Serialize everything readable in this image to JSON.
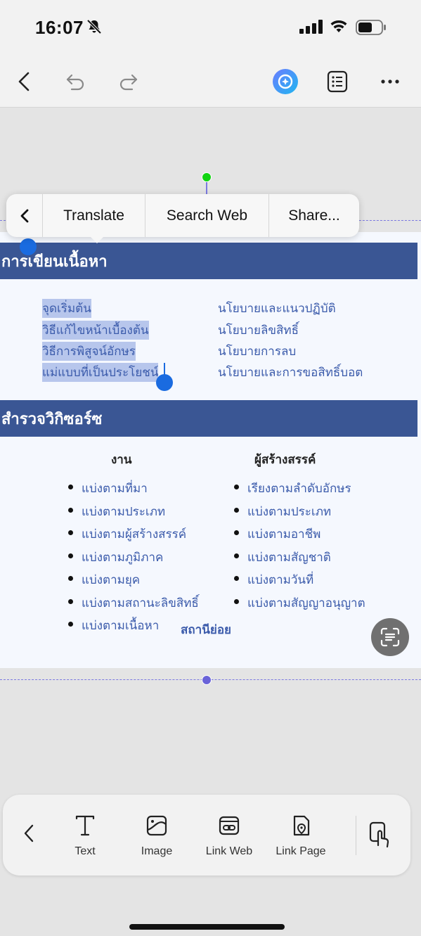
{
  "status": {
    "time": "16:07"
  },
  "toolbar": {
    "icons": [
      "back-icon",
      "undo-icon",
      "redo-icon",
      "ai-assistant-icon",
      "outline-icon",
      "more-icon"
    ]
  },
  "popup": {
    "items": [
      "Translate",
      "Search Web",
      "Share..."
    ]
  },
  "page": {
    "section1": {
      "title": "การเขียนเนื้อหา",
      "left_links": [
        "จุดเริ่มต้น",
        "วิธีแก้ไขหน้าเบื้องต้น",
        "วิธีการพิสูจน์อักษร",
        "แม่แบบที่เป็นประโยชน์"
      ],
      "right_links": [
        "นโยบายและแนวปฏิบัติ",
        "นโยบายลิขสิทธิ์",
        "นโยบายการลบ",
        "นโยบายและการขอสิทธิ์บอต"
      ]
    },
    "section2": {
      "title": "สำรวจวิกิซอร์ซ",
      "col1_title": "งาน",
      "col1_items": [
        "แบ่งตามที่มา",
        "แบ่งตามประเภท",
        "แบ่งตามผู้สร้างสรรค์",
        "แบ่งตามภูมิภาค",
        "แบ่งตามยุค",
        "แบ่งตามสถานะลิขสิทธิ์",
        "แบ่งตามเนื้อหา"
      ],
      "col2_title": "ผู้สร้างสรรค์",
      "col2_items": [
        "เรียงตามลำดับอักษร",
        "แบ่งตามประเภท",
        "แบ่งตามอาชีพ",
        "แบ่งตามสัญชาติ",
        "แบ่งตามวันที่",
        "แบ่งตามสัญญาอนุญาต"
      ],
      "footer": "สถานีย่อย"
    }
  },
  "bottom_bar": {
    "items": [
      "Text",
      "Image",
      "Link Web",
      "Link Page"
    ]
  }
}
